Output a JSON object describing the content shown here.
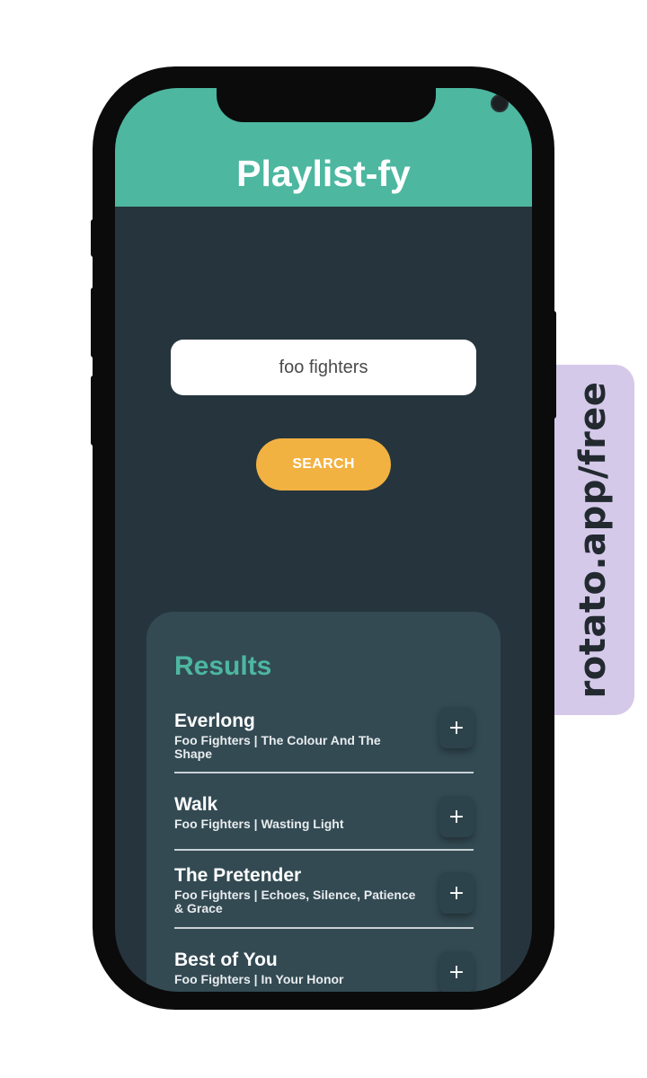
{
  "watermark": {
    "text": "rotato.app/free"
  },
  "app": {
    "title": "Playlist-fy"
  },
  "search": {
    "value": "foo fighters",
    "button_label": "SEARCH"
  },
  "results": {
    "heading": "Results",
    "items": [
      {
        "title": "Everlong",
        "meta": "Foo Fighters | The Colour And The Shape",
        "add_label": "+"
      },
      {
        "title": "Walk",
        "meta": "Foo Fighters | Wasting Light",
        "add_label": "+"
      },
      {
        "title": "The Pretender",
        "meta": "Foo Fighters | Echoes, Silence, Patience & Grace",
        "add_label": "+"
      },
      {
        "title": "Best of You",
        "meta": "Foo Fighters | In Your Honor",
        "add_label": "+"
      }
    ]
  },
  "colors": {
    "header": "#4db7a0",
    "background": "#26353d",
    "card": "#334a53",
    "button": "#f2b242",
    "accent": "#4db7a0"
  }
}
